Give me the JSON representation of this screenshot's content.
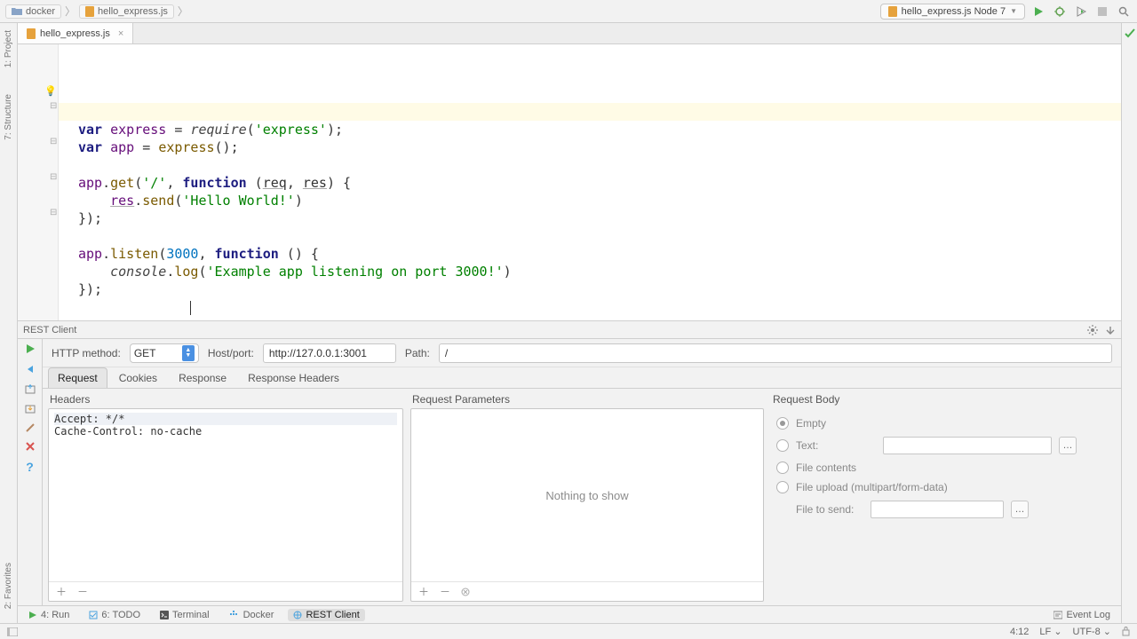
{
  "breadcrumb": {
    "folder": "docker",
    "file": "hello_express.js"
  },
  "run_config": {
    "label": "hello_express.js Node 7"
  },
  "editor": {
    "tab_label": "hello_express.js",
    "code_lines": [
      {
        "t": "var-decl",
        "raw": "var express = require('express');"
      },
      {
        "t": "var-decl",
        "raw": "var app = express();"
      },
      {
        "t": "blank",
        "raw": ""
      },
      {
        "t": "get",
        "raw": "app.get('/', function (req, res) {"
      },
      {
        "t": "send",
        "raw": "    res.send('Hello World!')"
      },
      {
        "t": "close",
        "raw": "});"
      },
      {
        "t": "blank",
        "raw": ""
      },
      {
        "t": "listen",
        "raw": "app.listen(3000, function () {"
      },
      {
        "t": "log",
        "raw": "    console.log('Example app listening on port 3000!')"
      },
      {
        "t": "close",
        "raw": "});"
      }
    ],
    "strings": {
      "kw_var": "var",
      "id_express": "express",
      "id_app": "app",
      "fn_require": "require",
      "str_express": "'express'",
      "fn_get": "get",
      "str_root": "'/'",
      "kw_function": "function",
      "param_req": "req",
      "param_res": "res",
      "id_res": "res",
      "fn_send": "send",
      "str_hello": "'Hello World!'",
      "fn_listen": "listen",
      "num_3000": "3000",
      "id_console": "console",
      "fn_log": "log",
      "str_listening": "'Example app listening on port 3000!'",
      "close": "});"
    }
  },
  "rest": {
    "title": "REST Client",
    "method_label": "HTTP method:",
    "method_value": "GET",
    "host_label": "Host/port:",
    "host_value": "http://127.0.0.1:3001",
    "path_label": "Path:",
    "path_value": "/",
    "tabs": {
      "request": "Request",
      "cookies": "Cookies",
      "response": "Response",
      "response_headers": "Response Headers"
    },
    "headers_title": "Headers",
    "headers": [
      "Accept: */*",
      "Cache-Control: no-cache"
    ],
    "params_title": "Request Parameters",
    "params_empty": "Nothing to show",
    "body_title": "Request Body",
    "body_options": {
      "empty": "Empty",
      "text": "Text:",
      "file_contents": "File contents",
      "file_upload": "File upload (multipart/form-data)",
      "file_to_send": "File to send:"
    }
  },
  "bottom_tabs": {
    "run": "4: Run",
    "todo": "6: TODO",
    "terminal": "Terminal",
    "docker": "Docker",
    "rest": "REST Client",
    "event_log": "Event Log"
  },
  "left_strip": {
    "project": "1: Project",
    "structure": "7: Structure",
    "favorites": "2: Favorites"
  },
  "status": {
    "pos": "4:12",
    "line_sep": "LF",
    "encoding": "UTF-8"
  }
}
